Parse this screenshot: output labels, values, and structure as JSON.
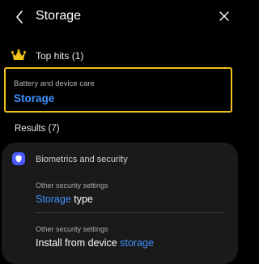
{
  "header": {
    "title": "Storage",
    "back_icon": "back-arrow-icon",
    "close_icon": "close-icon"
  },
  "top_hits": {
    "label": "Top hits (1)",
    "icon": "crown-icon",
    "icon_color": "#f2c21b",
    "item": {
      "category": "Battery and device care",
      "name": "Storage"
    }
  },
  "results": {
    "label": "Results (7)",
    "group": {
      "title": "Biometrics and security",
      "icon": "shield-icon",
      "icon_color": "#4a5cff",
      "items": [
        {
          "category": "Other security settings",
          "highlight": "Storage",
          "rest": " type"
        },
        {
          "category": "Other security settings",
          "prefix": "Install from device ",
          "highlight": "storage"
        }
      ]
    }
  },
  "colors": {
    "background": "#000000",
    "card": "#1a1a1a",
    "accent_blue": "#3e91ff",
    "highlight_border": "#f2c21b"
  }
}
